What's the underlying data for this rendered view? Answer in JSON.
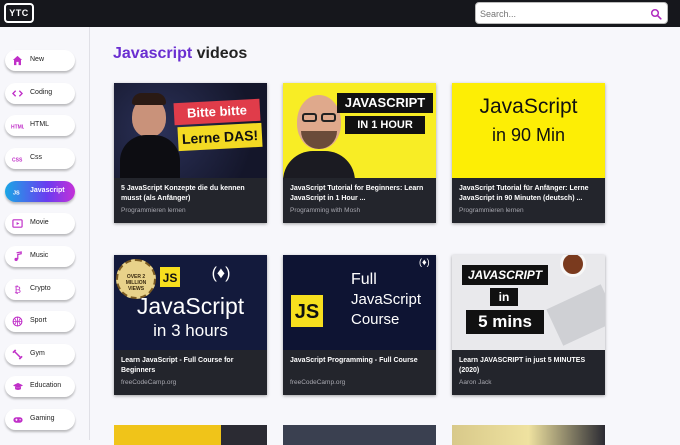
{
  "app": {
    "logo": "YTC"
  },
  "search": {
    "placeholder": "Search..."
  },
  "sidebar": {
    "items": [
      {
        "label": "New",
        "icon": "home-icon",
        "color": "#c02fc8"
      },
      {
        "label": "Coding",
        "icon": "code-icon",
        "color": "#c02fc8"
      },
      {
        "label": "HTML",
        "icon": "html-icon",
        "color": "#c02fc8"
      },
      {
        "label": "Css",
        "icon": "css-icon",
        "color": "#c02fc8"
      },
      {
        "label": "Javascript",
        "icon": "js-icon",
        "active": true
      },
      {
        "label": "Movie",
        "icon": "movie-icon",
        "color": "#c02fc8"
      },
      {
        "label": "Music",
        "icon": "music-icon",
        "color": "#c02fc8"
      },
      {
        "label": "Crypto",
        "icon": "bitcoin-icon",
        "color": "#c02fc8"
      },
      {
        "label": "Sport",
        "icon": "basketball-icon",
        "color": "#c02fc8"
      },
      {
        "label": "Gym",
        "icon": "dumbbell-icon",
        "color": "#c02fc8"
      },
      {
        "label": "Education",
        "icon": "graduation-cap-icon",
        "color": "#c02fc8"
      },
      {
        "label": "Gaming",
        "icon": "gamepad-icon",
        "color": "#c02fc8"
      }
    ]
  },
  "main": {
    "heading_accent": "Javascript",
    "heading_rest": " videos",
    "videos": [
      {
        "title": "5 JavaScript Konzepte die du kennen musst (als Anfänger)",
        "channel": "Programmieren lernen",
        "thumb": {
          "line1": "Bitte bitte",
          "line2": "Lerne DAS!"
        }
      },
      {
        "title": "JavaScript Tutorial for Beginners: Learn JavaScript in 1 Hour ...",
        "channel": "Programming with Mosh",
        "thumb": {
          "line1": "JAVASCRIPT",
          "line2": "IN 1 HOUR"
        }
      },
      {
        "title": "JavaScript Tutorial für Anfänger: Lerne JavaScript in 90 Minuten (deutsch) ...",
        "channel": "Programmieren lernen",
        "thumb": {
          "line1": "JavaScript",
          "line2": "in 90 Min"
        }
      },
      {
        "title": "Learn JavaScript - Full Course for Beginners",
        "channel": "freeCodeCamp.org",
        "thumb": {
          "badge": "JS",
          "line1": "JavaScript",
          "line2": "in 3 hours",
          "stamp": "OVER 2 MILLION VIEWS"
        }
      },
      {
        "title": "JavaScript Programming - Full Course",
        "channel": "freeCodeCamp.org",
        "thumb": {
          "badge": "JS",
          "line1": "Full",
          "line2": "JavaScript",
          "line3": "Course"
        }
      },
      {
        "title": "Learn JAVASCRIPT in just 5 MINUTES (2020)",
        "channel": "Aaron Jack",
        "thumb": {
          "line1": "JAVASCRIPT",
          "line2": "in",
          "line3": "5 mins"
        }
      }
    ]
  }
}
